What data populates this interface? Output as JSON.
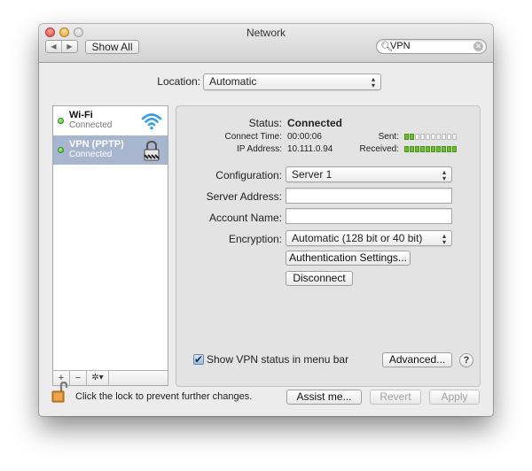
{
  "window": {
    "title": "Network",
    "toolbar": {
      "back_glyph": "◀",
      "forward_glyph": "▶",
      "show_all_label": "Show All",
      "search_value": "VPN",
      "search_icon": "magnifier-icon",
      "search_clear_glyph": "✕"
    }
  },
  "location": {
    "label": "Location:",
    "value": "Automatic"
  },
  "sidebar": {
    "services": [
      {
        "name": "Wi-Fi",
        "status": "Connected",
        "icon": "wifi-icon",
        "status_color": "#3fb52a",
        "selected": false
      },
      {
        "name": "VPN (PPTP)",
        "status": "Connected",
        "icon": "padlock-icon",
        "status_color": "#3fb52a",
        "selected": true
      }
    ],
    "add_glyph": "+",
    "remove_glyph": "−",
    "action_glyph": "✲▾"
  },
  "panel": {
    "status_label": "Status:",
    "status_value": "Connected",
    "connect_time_label": "Connect Time:",
    "connect_time_value": "00:00:06",
    "ip_label": "IP Address:",
    "ip_value": "10.111.0.94",
    "sent_label": "Sent:",
    "sent_level": 2,
    "received_label": "Received:",
    "received_level": 10,
    "meter_segments": 10,
    "meter_color": "#6fbe2e",
    "configuration_label": "Configuration:",
    "configuration_value": "Server 1",
    "server_address_label": "Server Address:",
    "server_address_value": "",
    "account_name_label": "Account Name:",
    "account_name_value": "",
    "encryption_label": "Encryption:",
    "encryption_value": "Automatic (128 bit or 40 bit)",
    "auth_settings_label": "Authentication Settings...",
    "disconnect_label": "Disconnect",
    "show_status_label": "Show VPN status in menu bar",
    "show_status_checked": true,
    "advanced_label": "Advanced...",
    "help_glyph": "?"
  },
  "footer": {
    "lock_text": "Click the lock to prevent further changes.",
    "assist_label": "Assist me...",
    "revert_label": "Revert",
    "apply_label": "Apply"
  }
}
